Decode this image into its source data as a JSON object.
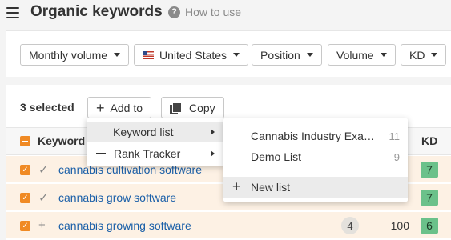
{
  "header": {
    "title": "Organic keywords",
    "help_label": "How to use",
    "help_icon": "question-circle-icon",
    "menu_icon": "hamburger-icon"
  },
  "filters": {
    "monthly_volume": "Monthly volume",
    "country": "United States",
    "country_icon": "us-flag-icon",
    "position": "Position",
    "volume": "Volume",
    "kd": "KD"
  },
  "toolbar": {
    "selected_count": "3 selected",
    "add_to_label": "Add to",
    "copy_label": "Copy"
  },
  "table": {
    "headers": {
      "keyword": "Keyword",
      "kd": "KD"
    },
    "rows": [
      {
        "checked": true,
        "mark": "✓",
        "keyword": "cannabis cultivation software",
        "volume": "",
        "position": "",
        "kd": "7"
      },
      {
        "checked": true,
        "mark": "✓",
        "keyword": "cannabis grow software",
        "volume": "",
        "position": "",
        "kd": "7"
      },
      {
        "checked": true,
        "mark": "+",
        "keyword": "cannabis growing software",
        "position": "4",
        "volume": "100",
        "kd": "6"
      }
    ]
  },
  "add_to_menu": {
    "items": [
      {
        "label": "Keyword list",
        "icon": "",
        "active": true
      },
      {
        "label": "Rank Tracker",
        "icon": "minus-icon",
        "active": false
      }
    ]
  },
  "keyword_list_menu": {
    "lists": [
      {
        "name": "Cannabis Industry Exa…",
        "count": "11"
      },
      {
        "name": "Demo List",
        "count": "9"
      }
    ],
    "new_list_label": "New list"
  },
  "colors": {
    "accent_orange": "#f08a24",
    "kd_green": "#6bc18a",
    "link_blue": "#1a5fa8",
    "row_highlight": "#fdf1e4"
  }
}
